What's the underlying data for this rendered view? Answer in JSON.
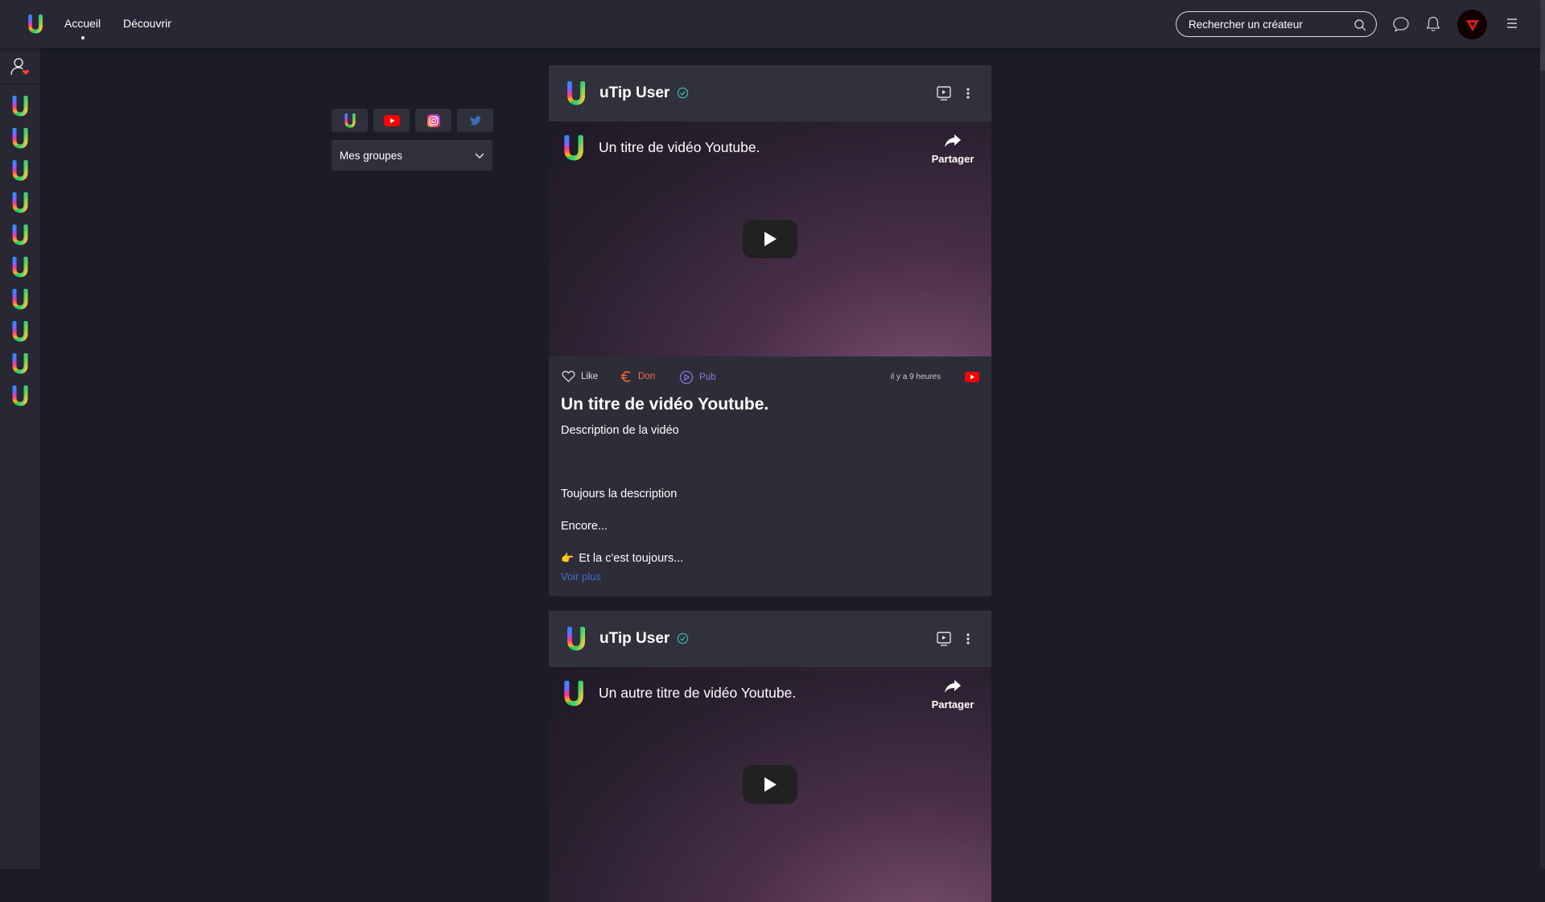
{
  "topbar": {
    "nav": [
      {
        "label": "Accueil",
        "active": true
      },
      {
        "label": "Découvrir",
        "active": false
      }
    ],
    "search": {
      "placeholder": "Rechercher un créateur"
    },
    "icons": [
      "chat-icon",
      "bell-icon",
      "menu-icon"
    ]
  },
  "leftrail": {
    "user_icon": "user-heart-icon",
    "creator_count": 10
  },
  "filters": {
    "socials": [
      "utip",
      "youtube",
      "instagram",
      "twitter"
    ],
    "groups_select": "Mes groupes"
  },
  "posts": [
    {
      "author": "uTip User",
      "verified": true,
      "video_title": "Un titre de vidéo Youtube.",
      "share_label": "Partager",
      "actions": {
        "like": "Like",
        "don": "Don",
        "pub": "Pub"
      },
      "timestamp": "il y a 9 heures",
      "source": "youtube",
      "title": "Un titre de vidéo Youtube.",
      "description": [
        "Description de la vidéo",
        "Toujours la description",
        "Encore...",
        "Et la c'est toujours..."
      ],
      "see_more": "Voir plus"
    },
    {
      "author": "uTip User",
      "verified": true,
      "video_title": "Un autre titre de vidéo Youtube.",
      "share_label": "Partager"
    }
  ],
  "colors": {
    "background": "#1b1c28",
    "panel": "#272833",
    "card": "#2c2d38",
    "don": "#ff6a3d",
    "pub": "#8a78d8",
    "link": "#3d6fd4",
    "youtube": "#ff0000"
  }
}
